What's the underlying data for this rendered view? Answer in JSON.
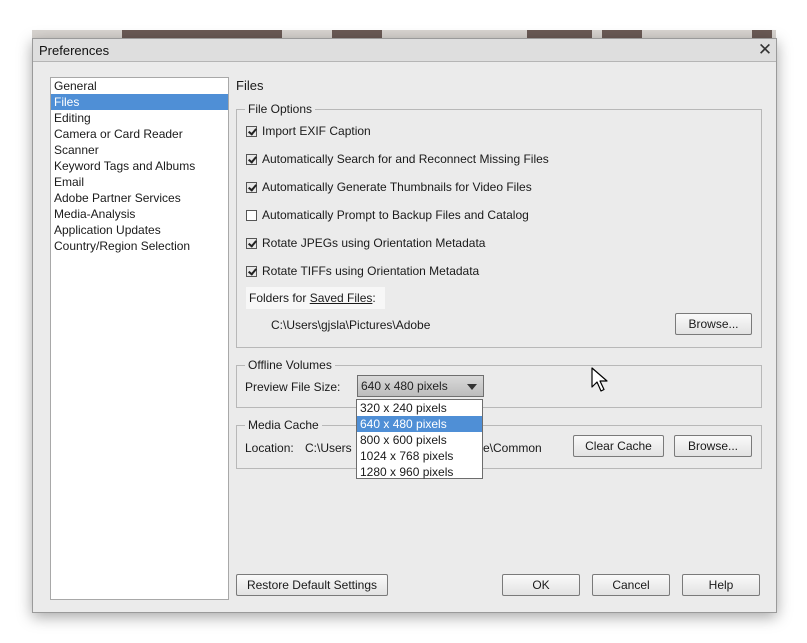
{
  "dialog": {
    "title": "Preferences"
  },
  "sidebar": {
    "items": [
      {
        "label": "General"
      },
      {
        "label": "Files",
        "selected": true
      },
      {
        "label": "Editing"
      },
      {
        "label": "Camera or Card Reader"
      },
      {
        "label": "Scanner"
      },
      {
        "label": "Keyword Tags and Albums"
      },
      {
        "label": "Email"
      },
      {
        "label": "Adobe Partner Services"
      },
      {
        "label": "Media-Analysis"
      },
      {
        "label": "Application Updates"
      },
      {
        "label": "Country/Region Selection"
      }
    ]
  },
  "main": {
    "section_title": "Files",
    "file_options": {
      "legend": "File Options",
      "checkboxes": [
        {
          "label": "Import EXIF Caption",
          "checked": true
        },
        {
          "label": "Automatically Search for and Reconnect Missing Files",
          "checked": true
        },
        {
          "label": "Automatically Generate Thumbnails for Video Files",
          "checked": true
        },
        {
          "label": "Automatically Prompt to Backup Files and Catalog",
          "checked": false
        },
        {
          "label": "Rotate JPEGs using Orientation Metadata",
          "checked": true
        },
        {
          "label": "Rotate TIFFs using Orientation Metadata",
          "checked": true
        }
      ],
      "folders_prefix": "Folders for ",
      "folders_link": "Saved Files",
      "folders_suffix": ":",
      "saved_path": "C:\\Users\\gjsla\\Pictures\\Adobe",
      "browse_label": "Browse..."
    },
    "offline_volumes": {
      "legend": "Offline Volumes",
      "preview_label": "Preview File Size:",
      "selected_value": "640 x 480 pixels",
      "options": [
        {
          "label": "320 x 240 pixels"
        },
        {
          "label": "640 x 480 pixels",
          "selected": true
        },
        {
          "label": "800 x 600 pixels"
        },
        {
          "label": "1024 x 768 pixels"
        },
        {
          "label": "1280 x 960 pixels"
        }
      ]
    },
    "media_cache": {
      "legend": "Media Cache",
      "location_label": "Location:",
      "location_start": "C:\\Users",
      "location_end": "e\\Common",
      "clear_cache_label": "Clear Cache",
      "browse_label": "Browse..."
    }
  },
  "footer": {
    "restore_label": "Restore Default Settings",
    "ok_label": "OK",
    "cancel_label": "Cancel",
    "help_label": "Help"
  },
  "colors": {
    "selection": "#4f8fd6",
    "dialog_bg": "#ebebeb"
  },
  "icons": {
    "close": "close-icon",
    "checkbox": "checkbox-icon",
    "dropdown": "chevron-down-icon",
    "cursor": "mouse-pointer-icon"
  }
}
